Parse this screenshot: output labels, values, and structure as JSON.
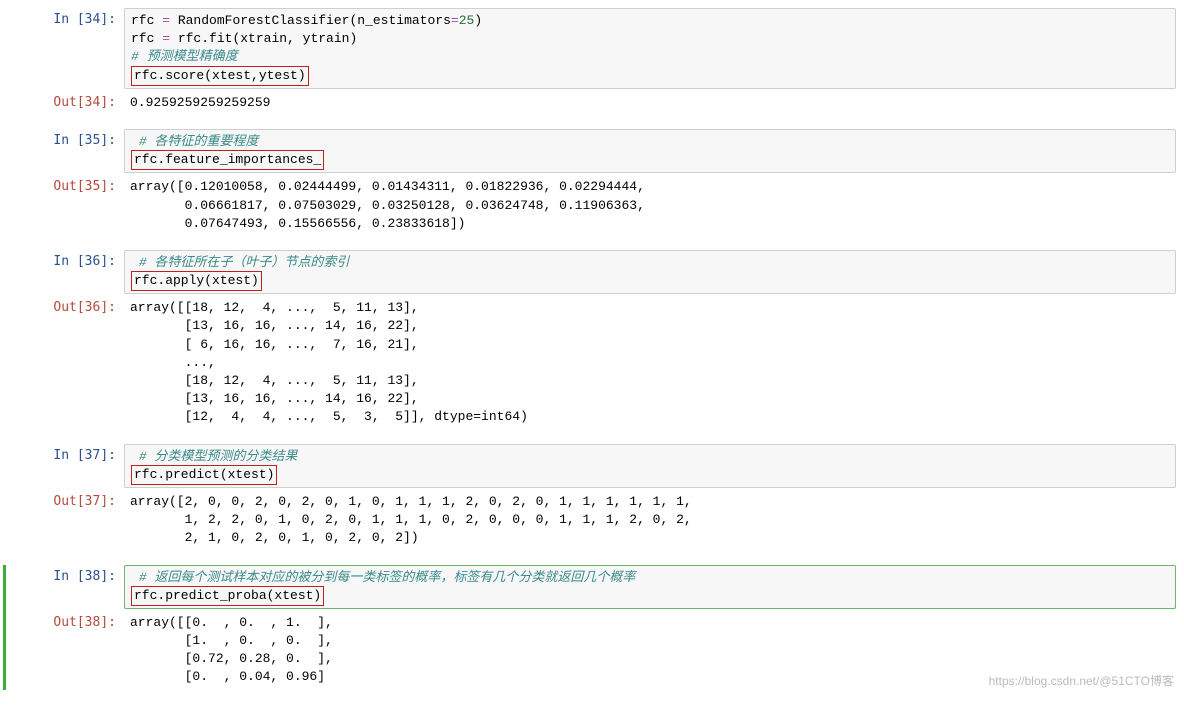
{
  "cells": {
    "c34": {
      "in_prompt": "In [34]:",
      "out_prompt": "Out[34]:",
      "line1_a": "rfc ",
      "line1_op1": "=",
      "line1_b": " RandomForestClassifier(n_estimators",
      "line1_op2": "=",
      "line1_num": "25",
      "line1_c": ")",
      "line2_a": "rfc ",
      "line2_op1": "=",
      "line2_b": " rfc.fit(xtrain, ytrain)",
      "comment": "# 预测模型精确度",
      "box": "rfc.score(xtest,ytest)",
      "output": "0.9259259259259259"
    },
    "c35": {
      "in_prompt": "In [35]:",
      "out_prompt": "Out[35]:",
      "comment": "# 各特征的重要程度",
      "box": "rfc.feature_importances_",
      "output": "array([0.12010058, 0.02444499, 0.01434311, 0.01822936, 0.02294444,\n       0.06661817, 0.07503029, 0.03250128, 0.03624748, 0.11906363,\n       0.07647493, 0.15566556, 0.23833618])"
    },
    "c36": {
      "in_prompt": "In [36]:",
      "out_prompt": "Out[36]:",
      "comment": "# 各特征所在子（叶子）节点的索引",
      "box": "rfc.apply(xtest)",
      "output": "array([[18, 12,  4, ...,  5, 11, 13],\n       [13, 16, 16, ..., 14, 16, 22],\n       [ 6, 16, 16, ...,  7, 16, 21],\n       ...,\n       [18, 12,  4, ...,  5, 11, 13],\n       [13, 16, 16, ..., 14, 16, 22],\n       [12,  4,  4, ...,  5,  3,  5]], dtype=int64)"
    },
    "c37": {
      "in_prompt": "In [37]:",
      "out_prompt": "Out[37]:",
      "comment": "# 分类模型预测的分类结果",
      "box": "rfc.predict(xtest)",
      "output": "array([2, 0, 0, 2, 0, 2, 0, 1, 0, 1, 1, 1, 2, 0, 2, 0, 1, 1, 1, 1, 1, 1,\n       1, 2, 2, 0, 1, 0, 2, 0, 1, 1, 1, 0, 2, 0, 0, 0, 1, 1, 1, 2, 0, 2,\n       2, 1, 0, 2, 0, 1, 0, 2, 0, 2])"
    },
    "c38": {
      "in_prompt": "In [38]:",
      "out_prompt": "Out[38]:",
      "comment": "# 返回每个测试样本对应的被分到每一类标签的概率，标签有几个分类就返回几个概率",
      "box": "rfc.predict_proba(xtest)",
      "output": "array([[0.  , 0.  , 1.  ],\n       [1.  , 0.  , 0.  ],\n       [0.72, 0.28, 0.  ],\n       [0.  , 0.04, 0.96]"
    }
  },
  "watermark": "https://blog.csdn.net/@51CTO博客"
}
